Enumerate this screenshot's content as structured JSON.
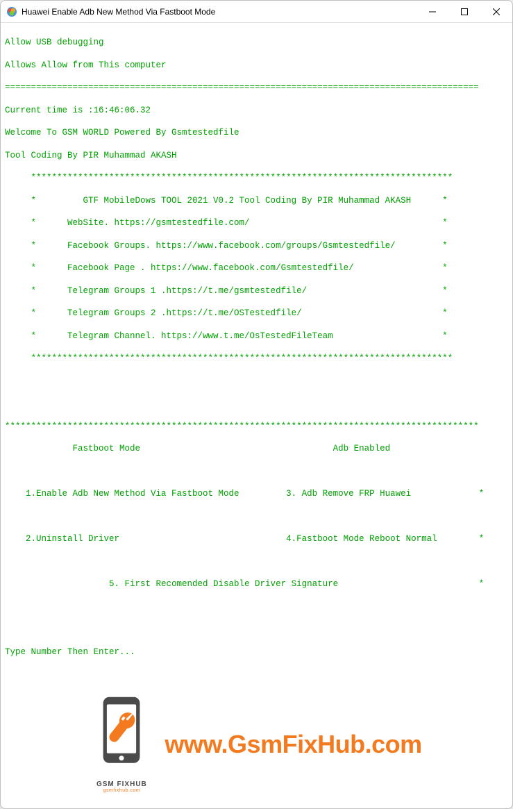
{
  "window": {
    "title": "Huawei Enable Adb New Method Via Fastboot Mode"
  },
  "terminal": {
    "line1": "Allow USB debugging",
    "line2": "Allows Allow from This computer",
    "separator1": "===========================================================================================",
    "line3": "Current time is :16:46:06.32",
    "line4": "Welcome To GSM WORLD Powered By Gsmtestedfile",
    "line5": "Tool Coding By PIR Muhammad AKASH",
    "starbox_top": "     *********************************************************************************",
    "banner1": "     *         GTF MobileDows TOOL 2021 V0.2 Tool Coding By PIR Muhammad AKASH      *",
    "banner2": "     *      WebSite. https://gsmtestedfile.com/                                     *",
    "banner3": "     *      Facebook Groups. https://www.facebook.com/groups/Gsmtestedfile/         *",
    "banner4": "     *      Facebook Page . https://www.facebook.com/Gsmtestedfile/                 *",
    "banner5": "     *      Telegram Groups 1 .https://t.me/gsmtestedfile/                          *",
    "banner6": "     *      Telegram Groups 2 .https://t.me/OSTestedfile/                           *",
    "banner7": "     *      Telegram Channel. https://www.t.me/OsTestedFileTeam                     *",
    "starbox_bot": "     *********************************************************************************",
    "separator2": "*******************************************************************************************",
    "modes": "             Fastboot Mode                                     Adb Enabled",
    "opt1": "    1.Enable Adb New Method Via Fastboot Mode         3. Adb Remove FRP Huawei             *",
    "opt2": "    2.Uninstall Driver                                4.Fastboot Mode Reboot Normal        *",
    "opt3": "                    5. First Recomended Disable Driver Signature                           *",
    "prompt": "Type Number Then Enter..."
  },
  "watermark": {
    "url": "www.GsmFixHub.com",
    "logo_label": "GSM FIXHUB",
    "logo_sub": "gsmfixhub.com"
  }
}
